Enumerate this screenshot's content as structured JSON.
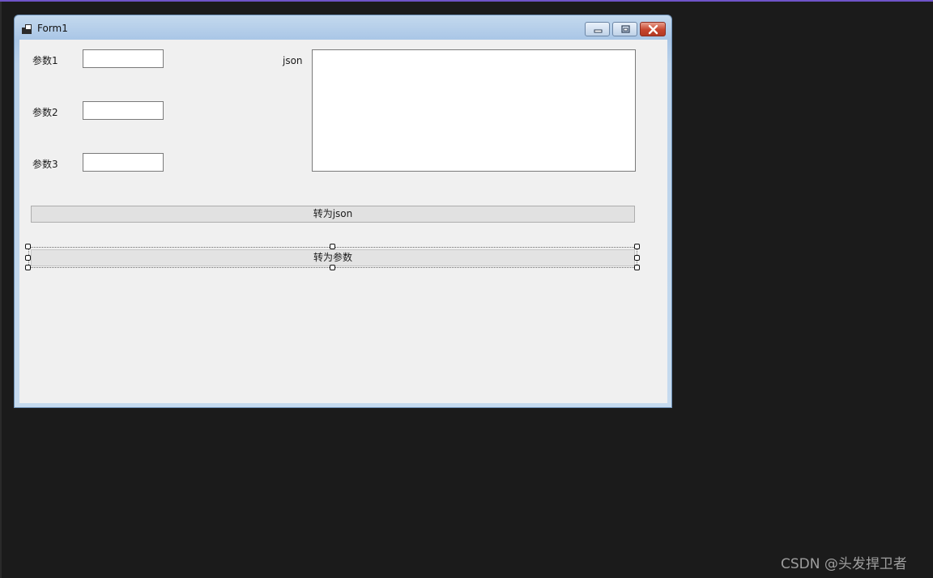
{
  "window": {
    "title": "Form1",
    "icons": {
      "app": "form-app-icon",
      "minimize": "minimize-icon",
      "maximize": "maximize-icon",
      "close": "close-icon"
    }
  },
  "form": {
    "param1_label": "参数1",
    "param2_label": "参数2",
    "param3_label": "参数3",
    "param1_value": "",
    "param2_value": "",
    "param3_value": "",
    "json_label": "json",
    "json_value": "",
    "to_json_button": "转为json",
    "to_params_button": "转为参数"
  },
  "watermark": "CSDN @头发捍卫者",
  "colors": {
    "accent": "#6f54c8",
    "background": "#1b1b1b",
    "form_client": "#f0f0f0",
    "close_button": "#c6442d"
  }
}
